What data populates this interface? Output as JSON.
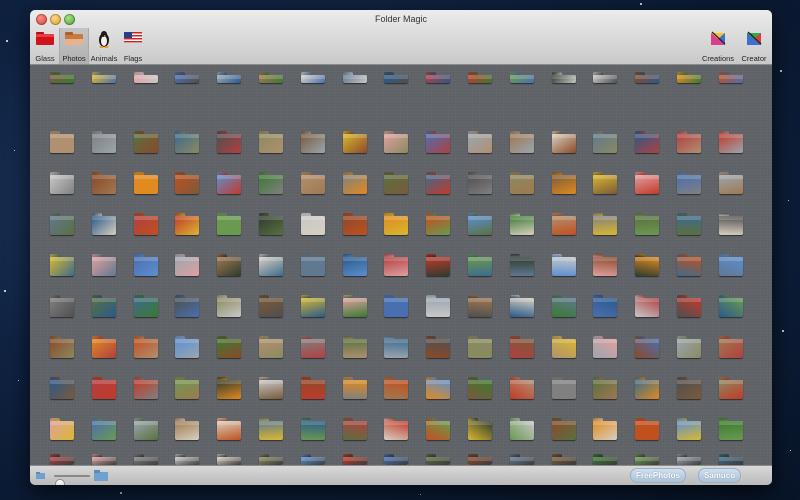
{
  "window": {
    "title": "Folder Magic"
  },
  "toolbar": {
    "left": [
      {
        "label": "Glass",
        "icon": "glass-folder-icon",
        "selected": false
      },
      {
        "label": "Photos",
        "icon": "photos-folder-icon",
        "selected": true
      },
      {
        "label": "Animals",
        "icon": "penguin-icon",
        "selected": false
      },
      {
        "label": "Flags",
        "icon": "us-flag-icon",
        "selected": false
      }
    ],
    "right": [
      {
        "label": "Creations",
        "icon": "creations-icon"
      },
      {
        "label": "Creator",
        "icon": "creator-icon"
      }
    ]
  },
  "grid": {
    "rows": 10,
    "columns": 17,
    "palette": [
      "#7a5a3a",
      "#5c8fd0",
      "#b04040",
      "#d9b830",
      "#3b7a32",
      "#c23a2a",
      "#e0a0a0",
      "#b09070",
      "#6a9a50",
      "#4a6fb0",
      "#808080",
      "#2f3b2f",
      "#9aa6b0",
      "#5a7040",
      "#c8c8c8",
      "#a07850",
      "#3d6b8c",
      "#8b4a2a",
      "#d8d0c0",
      "#4f4f4f",
      "#e08a20",
      "#607890",
      "#8a8a60",
      "#c05020",
      "#2a5a8a"
    ]
  },
  "bottom": {
    "zoom_value": 0.15,
    "buttons": [
      "FreePhotos",
      "Samuco"
    ],
    "slider_icon_small": "small-folder-icon",
    "slider_icon_large": "large-folder-icon"
  }
}
